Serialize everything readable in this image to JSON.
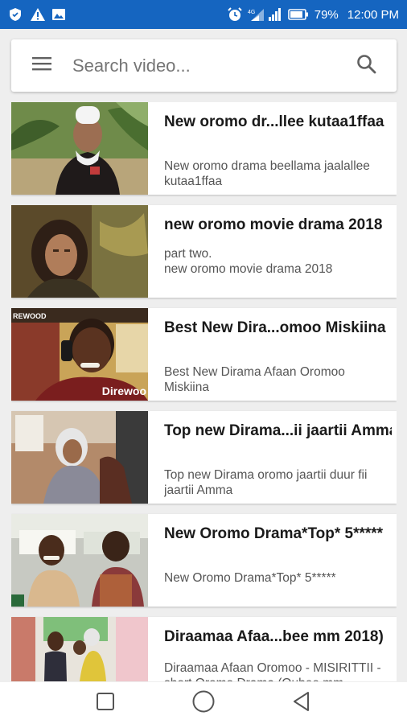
{
  "status_bar": {
    "battery": "79%",
    "time": "12:00 PM",
    "icons": [
      "shield-icon",
      "warning-icon",
      "image-icon",
      "alarm-icon",
      "signal-icon",
      "battery-icon"
    ]
  },
  "search": {
    "placeholder": "Search video..."
  },
  "videos": [
    {
      "title": "New oromo dr...llee kutaa1ffaa",
      "description": "New oromo drama beellama jaalallee kutaa1ffaa"
    },
    {
      "title": "new oromo movie drama 2018",
      "description": "part two.\nnew oromo movie drama 2018"
    },
    {
      "title": "Best New Dira...omoo Miskiina",
      "description": "Best New Dirama Afaan Oromoo Miskiina",
      "thumb_text": "Direwoo"
    },
    {
      "title": "Top new Dirama...ii jaartii Amma",
      "description": "Top new Dirama oromo jaartii duur fii jaartii Amma"
    },
    {
      "title": "New Oromo Drama*Top* 5*****",
      "description": "New Oromo Drama*Top* 5*****"
    },
    {
      "title": "Diraamaa Afaa...bee mm 2018)",
      "description": "Diraamaa Afaan Oromoo - MISIRITTII - short Oromo Drama (Oubee mm"
    }
  ],
  "nav": {
    "icons": [
      "square-icon",
      "circle-icon",
      "triangle-back-icon"
    ]
  },
  "colors": {
    "status_bar": "#1565c0",
    "background": "#eeeeee",
    "card": "#ffffff"
  }
}
